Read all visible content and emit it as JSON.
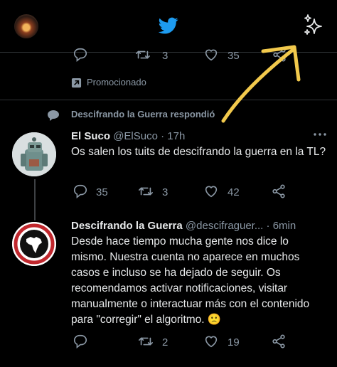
{
  "promoted_tweet": {
    "retweets": "3",
    "likes": "35",
    "promoted_label": "Promocionado"
  },
  "reply_context": {
    "label": "Descifrando la Guerra respondió"
  },
  "tweets": [
    {
      "name": "El Suco",
      "handle": "@ElSuco",
      "time": "· 17h",
      "text": "Os salen los tuits de descifrando la guerra en la TL?",
      "replies": "35",
      "retweets": "3",
      "likes": "42"
    },
    {
      "name": "Descifrando la Guerra",
      "handle": "@descifraguer...",
      "time": "· 6min",
      "text": "Desde hace tiempo mucha gente nos dice lo mismo. Nuestra cuenta no aparece en muchos casos e incluso se ha dejado de seguir. Os recomendamos activar notificaciones, visitar manualmente o interactuar más con el contenido para \"corregir\" el algoritmo. 🙁",
      "retweets": "2",
      "likes": "19"
    }
  ],
  "colors": {
    "accent": "#1d9bf0",
    "annotation": "#f2c94c",
    "muted": "#8b98a5",
    "background": "#000000"
  },
  "icons": {
    "header_left": "profile-avatar",
    "header_center": "twitter-bird-icon",
    "header_right": "sparkle-icon"
  }
}
